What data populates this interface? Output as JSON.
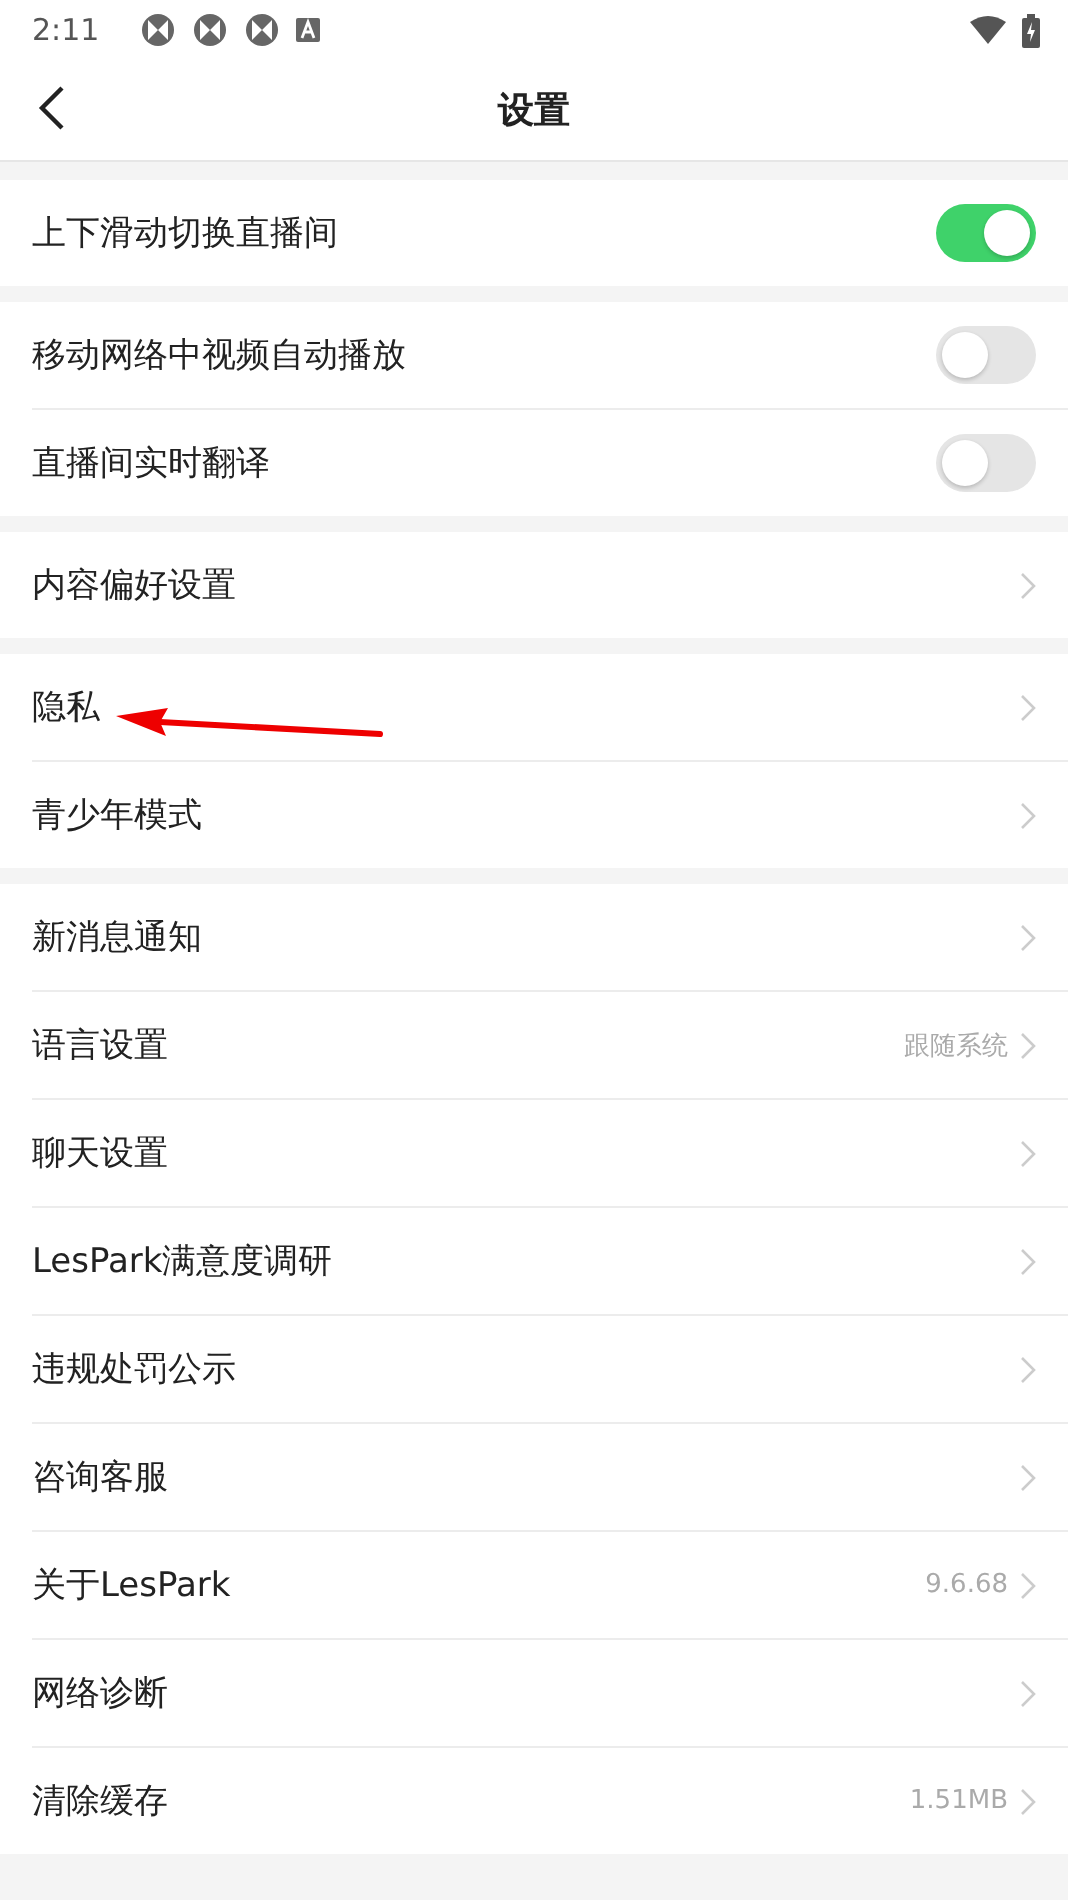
{
  "status_bar": {
    "time": "2:11"
  },
  "header": {
    "title": "设置"
  },
  "groups": [
    {
      "items": [
        {
          "kind": "toggle",
          "label": "上下滑动切换直播间",
          "on": true
        }
      ]
    },
    {
      "items": [
        {
          "kind": "toggle",
          "label": "移动网络中视频自动播放",
          "on": false
        },
        {
          "kind": "toggle",
          "label": "直播间实时翻译",
          "on": false
        }
      ]
    },
    {
      "items": [
        {
          "kind": "link",
          "label": "内容偏好设置"
        }
      ]
    },
    {
      "items": [
        {
          "kind": "link",
          "label": "隐私",
          "annotated": true
        },
        {
          "kind": "link",
          "label": "青少年模式"
        }
      ]
    },
    {
      "items": [
        {
          "kind": "link",
          "label": "新消息通知"
        },
        {
          "kind": "link",
          "label": "语言设置",
          "value": "跟随系统"
        },
        {
          "kind": "link",
          "label": "聊天设置"
        },
        {
          "kind": "link",
          "label": "LesPark满意度调研"
        },
        {
          "kind": "link",
          "label": "违规处罚公示"
        },
        {
          "kind": "link",
          "label": "咨询客服"
        },
        {
          "kind": "link",
          "label": "关于LesPark",
          "value": "9.6.68"
        },
        {
          "kind": "link",
          "label": "网络诊断"
        },
        {
          "kind": "link",
          "label": "清除缓存",
          "value": "1.51MB"
        }
      ]
    }
  ]
}
